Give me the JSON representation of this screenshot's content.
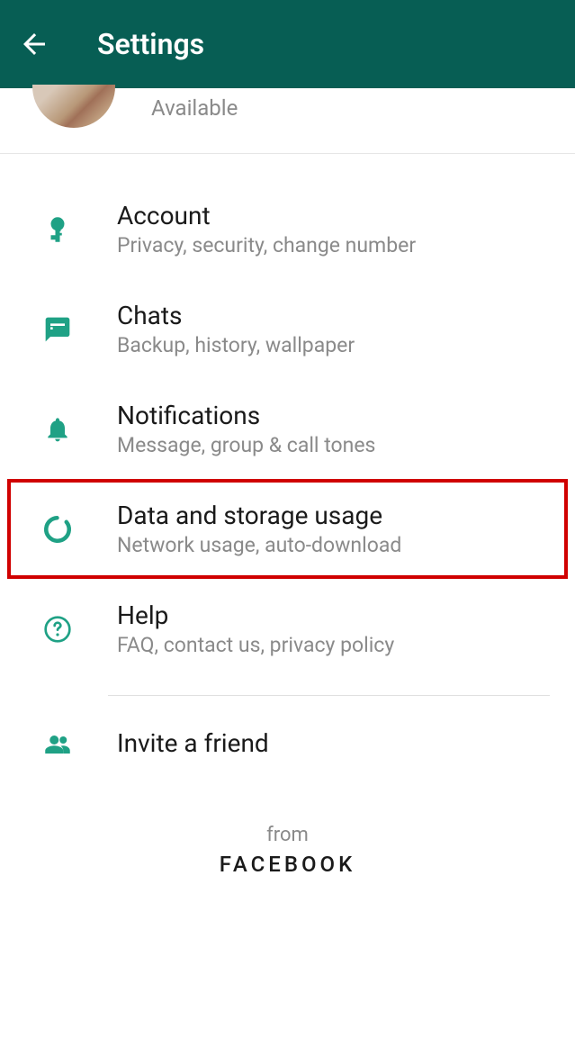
{
  "header": {
    "title": "Settings"
  },
  "profile": {
    "status": "Available"
  },
  "items": {
    "account": {
      "title": "Account",
      "subtitle": "Privacy, security, change number"
    },
    "chats": {
      "title": "Chats",
      "subtitle": "Backup, history, wallpaper"
    },
    "notifications": {
      "title": "Notifications",
      "subtitle": "Message, group & call tones"
    },
    "data": {
      "title": "Data and storage usage",
      "subtitle": "Network usage, auto-download"
    },
    "help": {
      "title": "Help",
      "subtitle": "FAQ, contact us, privacy policy"
    },
    "invite": {
      "title": "Invite a friend"
    }
  },
  "footer": {
    "from": "from",
    "brand": "FACEBOOK"
  },
  "colors": {
    "primary": "#075e54",
    "accent": "#1fa185"
  }
}
